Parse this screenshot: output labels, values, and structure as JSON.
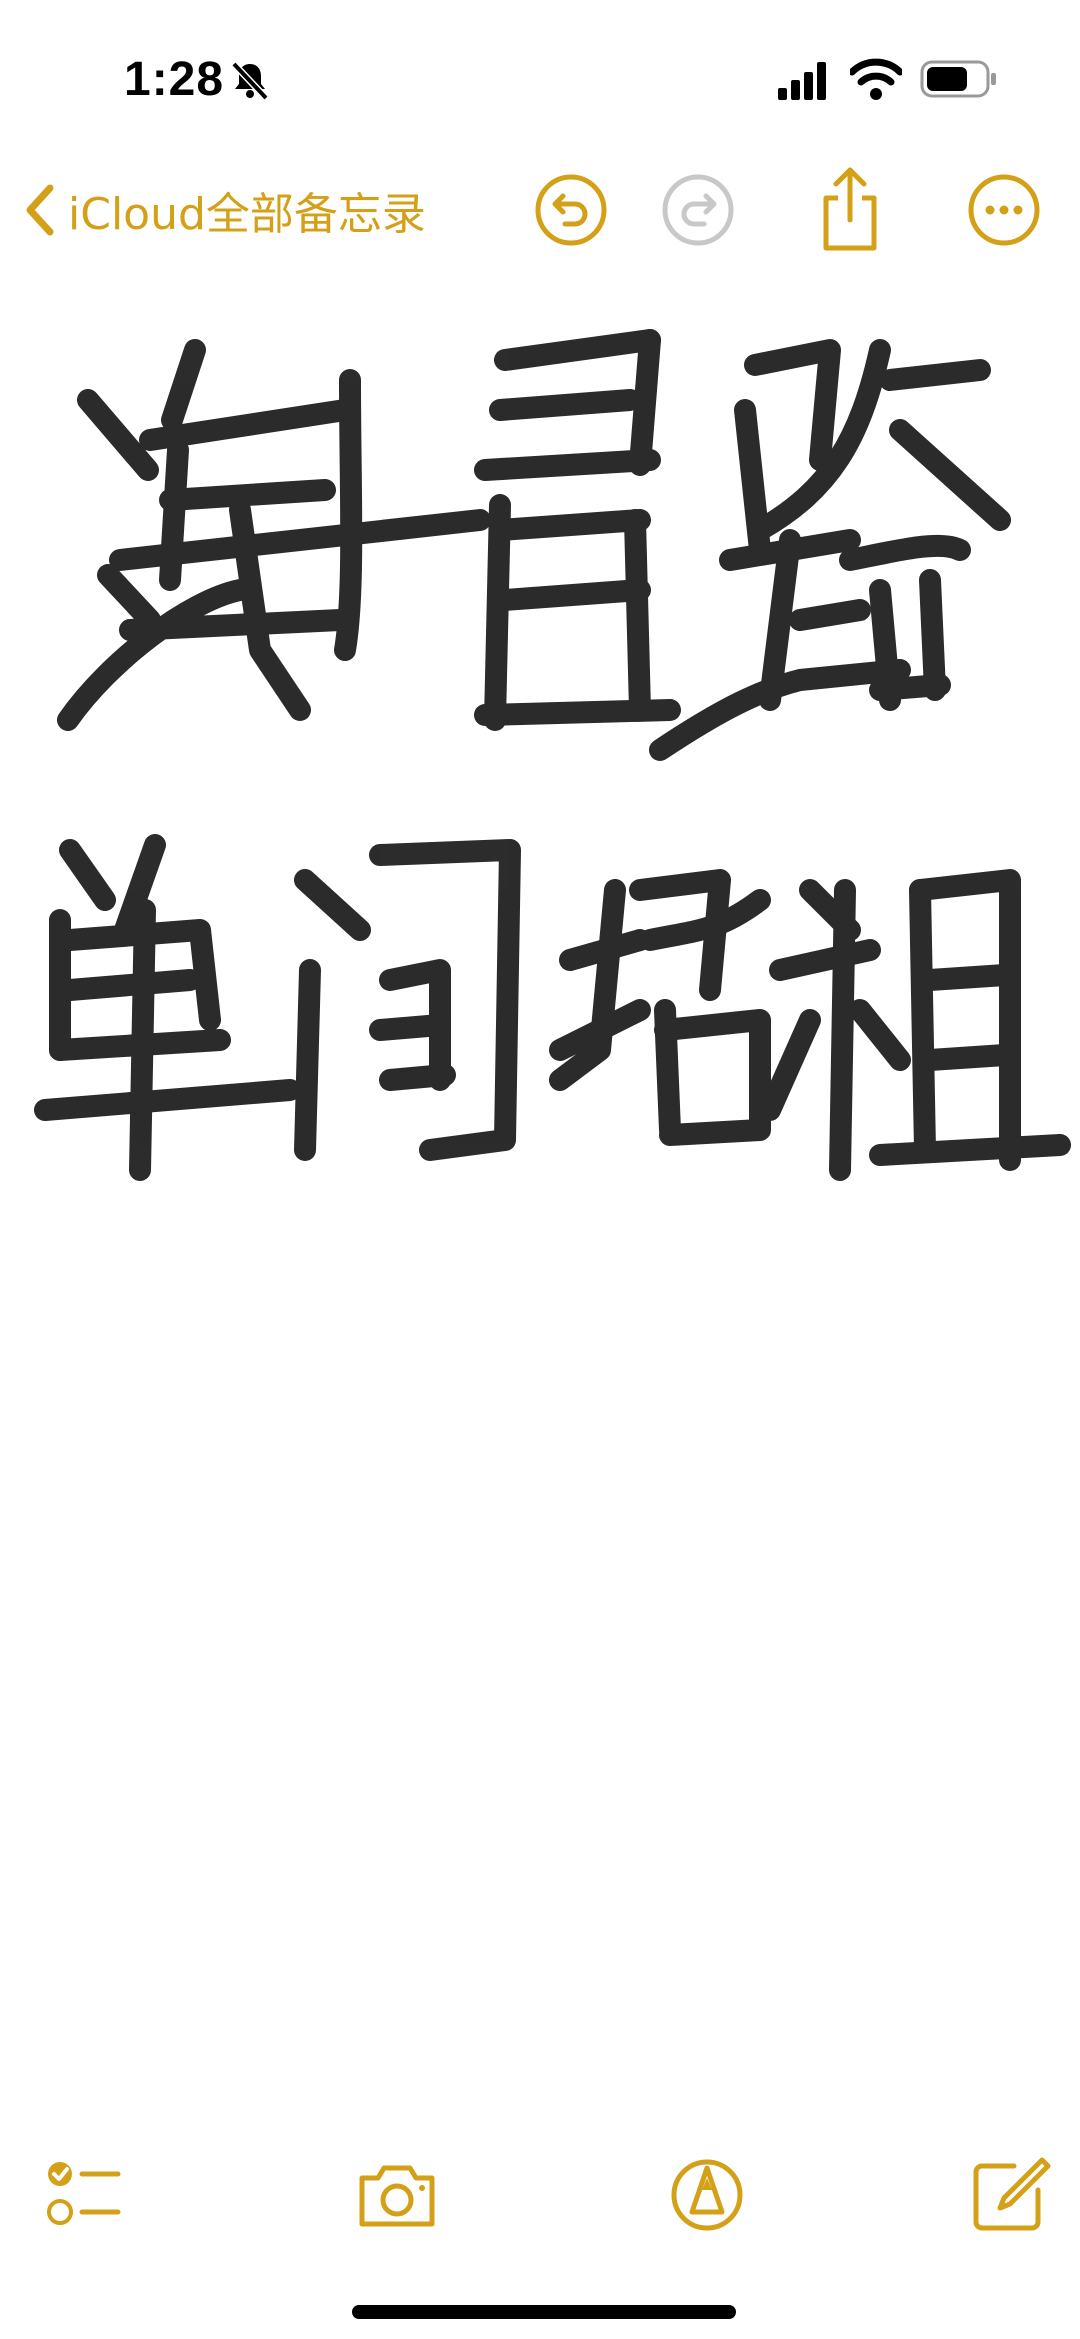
{
  "status_bar": {
    "time": "1:28"
  },
  "nav": {
    "back_label": "iCloud全部备忘录"
  },
  "icons": {
    "back": "chevron-left-icon",
    "undo": "undo-icon",
    "redo": "redo-icon",
    "share": "share-icon",
    "more": "ellipsis-circle-icon",
    "checklist": "checklist-icon",
    "camera": "camera-icon",
    "markup": "pen-tip-icon",
    "compose": "compose-icon",
    "silent": "bell-slash-icon",
    "signal": "cellular-signal-icon",
    "wifi": "wifi-icon",
    "battery": "battery-icon"
  },
  "drawing": {
    "handwritten_lines": [
      "海昌路",
      "单间招租"
    ]
  },
  "colors": {
    "accent": "#d4a017",
    "accent_disabled": "#c8c8c8",
    "ink": "#1a1a1a",
    "background": "#ffffff"
  }
}
